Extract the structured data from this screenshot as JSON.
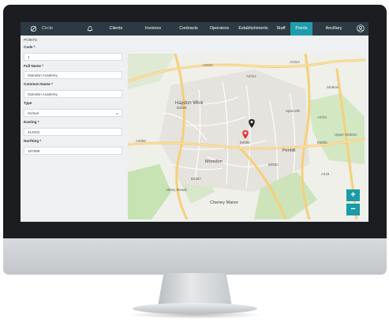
{
  "app": {
    "logo_text": "Circle"
  },
  "nav": {
    "items": [
      "Clients",
      "Invoices",
      "Contracts",
      "Operators",
      "Establishments",
      "Staff",
      "Points",
      "Ancillary"
    ],
    "active": "Points"
  },
  "form": {
    "section_title": "POINTS",
    "code_label": "Code *",
    "code_value": "1",
    "full_name_label": "Full Name *",
    "full_name_value": "Swindon Academy",
    "common_name_label": "Common Name *",
    "common_name_value": "Swindon Academy",
    "type_label": "Type",
    "type_value": "School",
    "easting_label": "Easting *",
    "easting_value": "414231",
    "northing_label": "Northing *",
    "northing_value": "187689"
  },
  "map": {
    "labels": [
      "A4312",
      "A4312",
      "A3102",
      "B4006",
      "B4006",
      "Haydon Wick",
      "Moredon",
      "Penhill",
      "Abbey Meads",
      "Cheney Manor",
      "B4587",
      "A4259",
      "B4534",
      "A4311",
      "B4006",
      "Upper Stratton",
      "Sparcells",
      "Stratton",
      "A419"
    ],
    "zoom_in": "+",
    "zoom_out": "−",
    "marker_colors": {
      "selected": "#e03a3a",
      "other": "#222222"
    },
    "road_color": "#f6cf7a"
  }
}
